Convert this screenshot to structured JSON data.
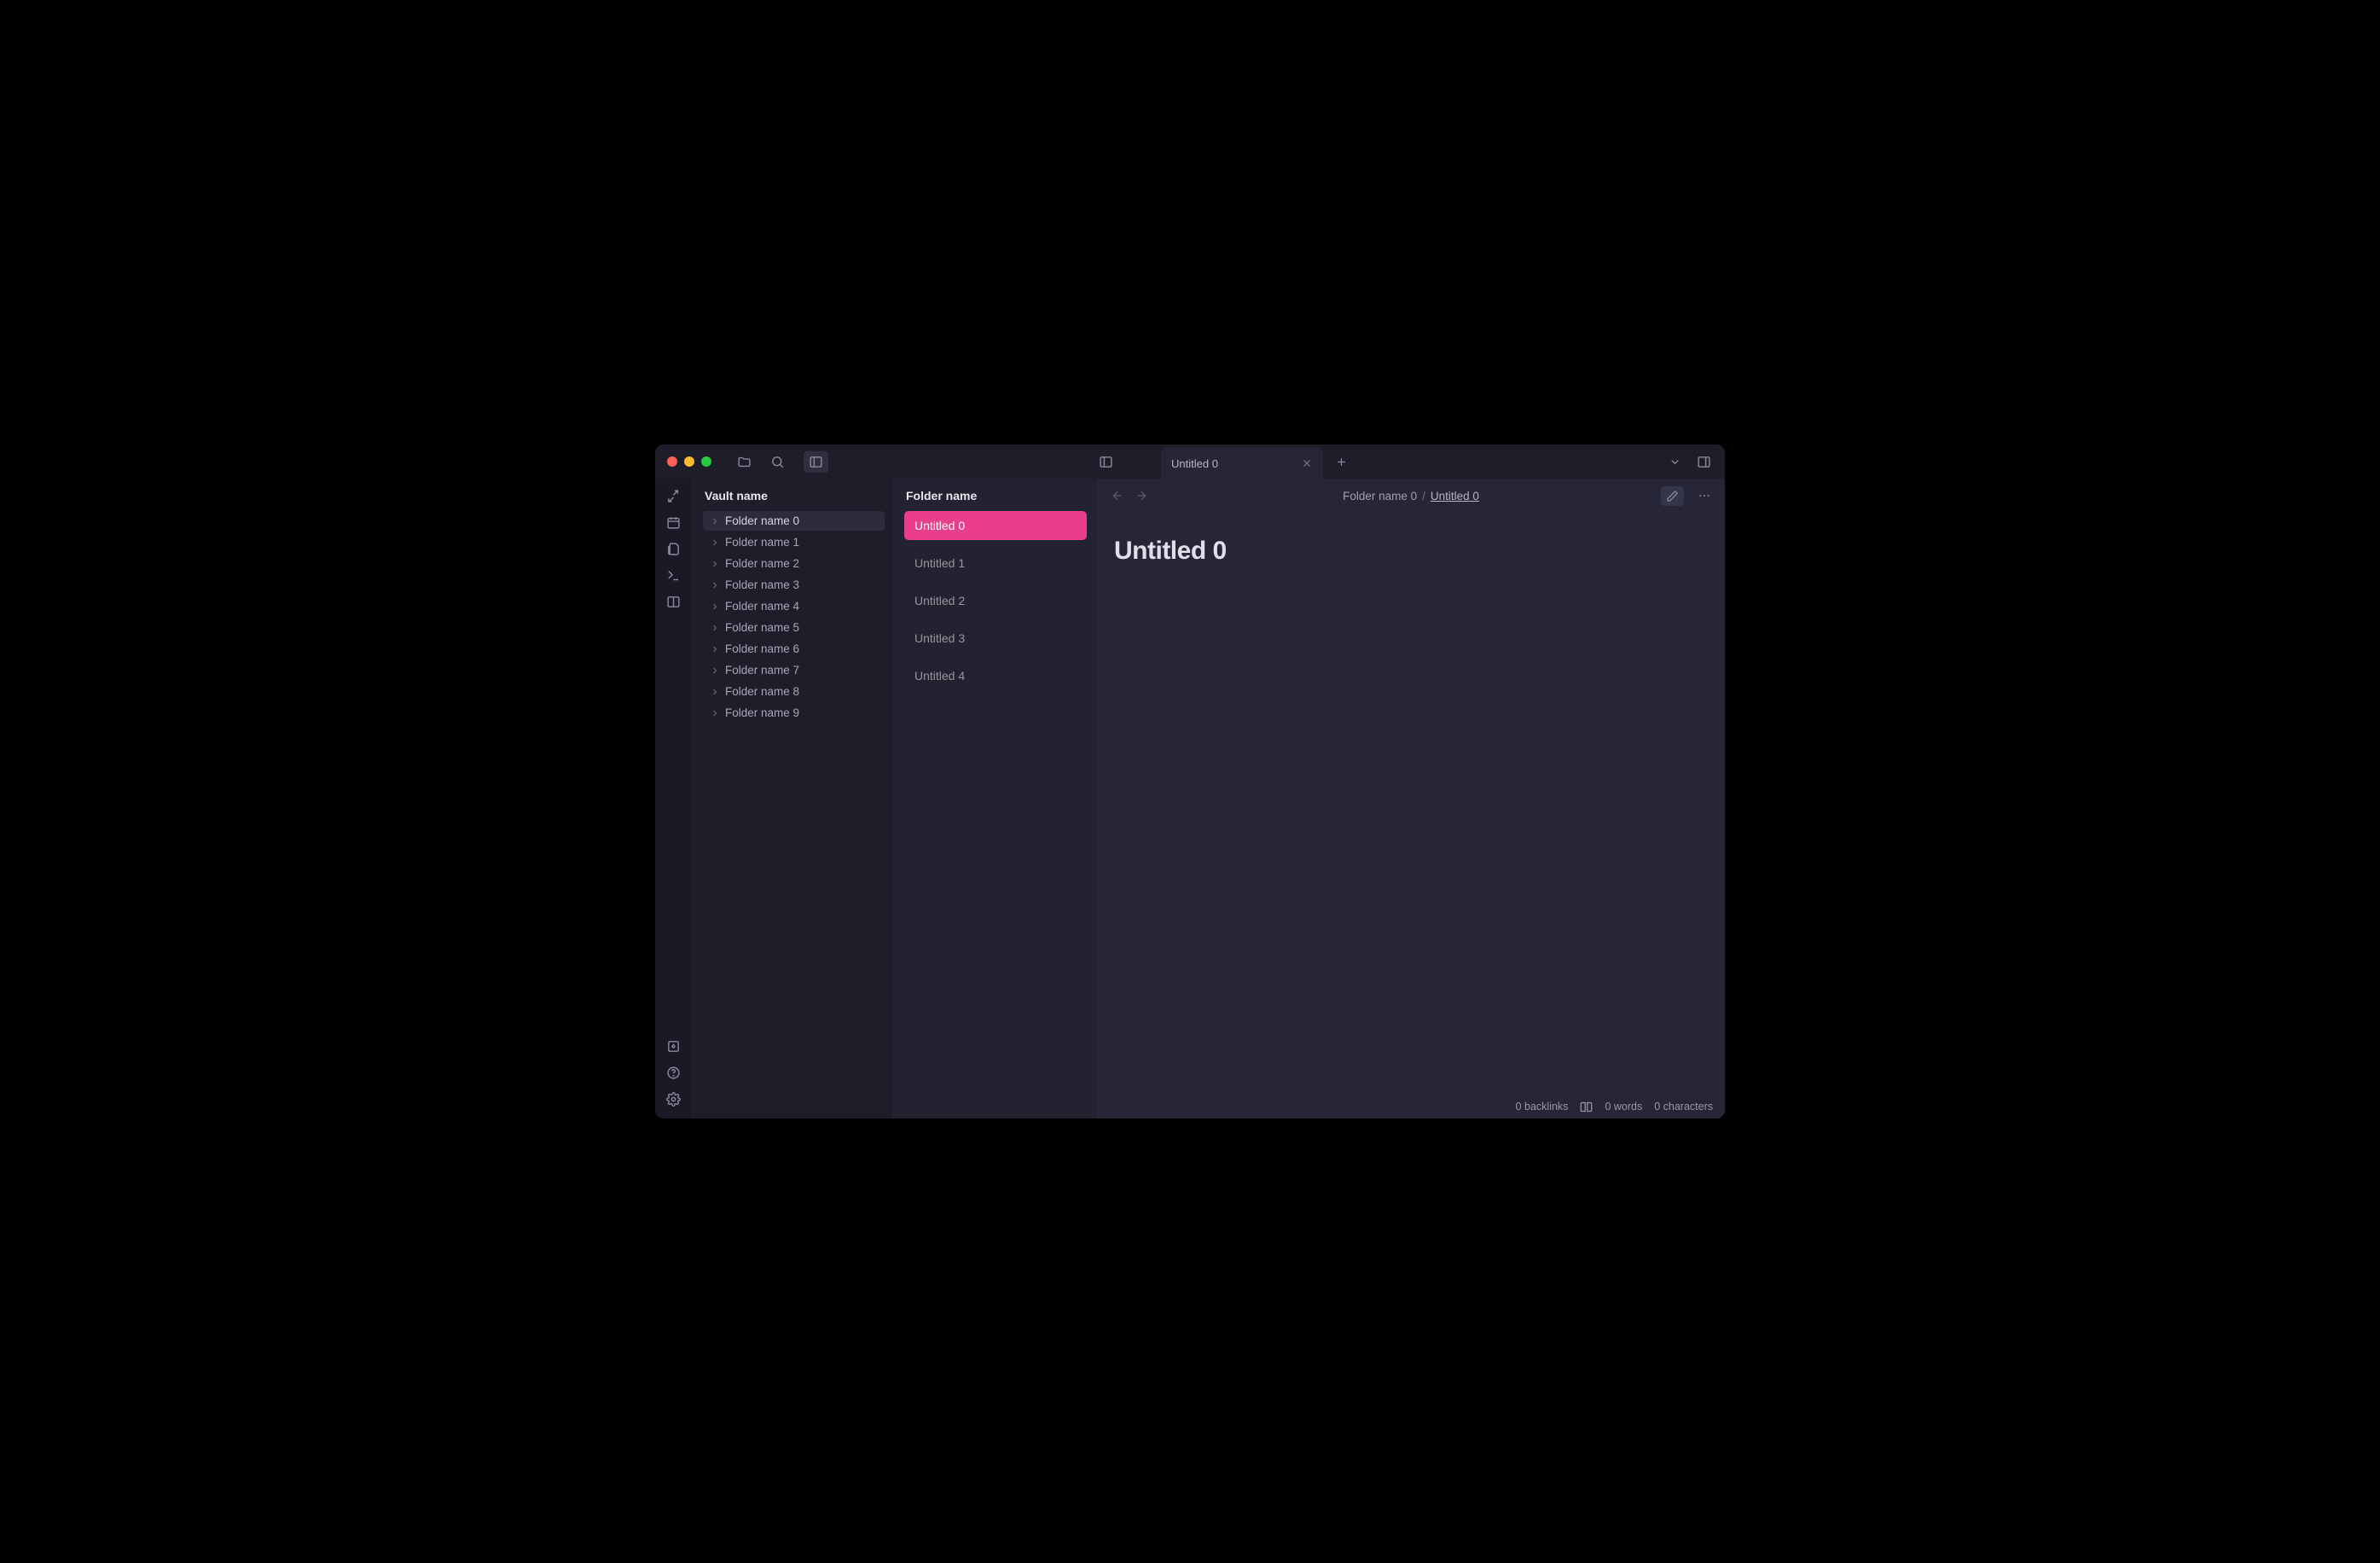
{
  "tab": {
    "title": "Untitled 0"
  },
  "vault": {
    "title": "Vault name",
    "folders": [
      {
        "label": "Folder name 0",
        "active": true
      },
      {
        "label": "Folder name 1",
        "active": false
      },
      {
        "label": "Folder name 2",
        "active": false
      },
      {
        "label": "Folder name 3",
        "active": false
      },
      {
        "label": "Folder name 4",
        "active": false
      },
      {
        "label": "Folder name 5",
        "active": false
      },
      {
        "label": "Folder name 6",
        "active": false
      },
      {
        "label": "Folder name 7",
        "active": false
      },
      {
        "label": "Folder name 8",
        "active": false
      },
      {
        "label": "Folder name 9",
        "active": false
      }
    ]
  },
  "folder": {
    "title": "Folder name",
    "files": [
      {
        "label": "Untitled 0",
        "active": true
      },
      {
        "label": "Untitled 1",
        "active": false
      },
      {
        "label": "Untitled 2",
        "active": false
      },
      {
        "label": "Untitled 3",
        "active": false
      },
      {
        "label": "Untitled 4",
        "active": false
      }
    ]
  },
  "breadcrumb": {
    "parent": "Folder name 0",
    "current": "Untitled 0"
  },
  "editor": {
    "title": "Untitled 0"
  },
  "status": {
    "backlinks": "0 backlinks",
    "words": "0 words",
    "characters": "0 characters"
  },
  "colors": {
    "accent": "#e83e8c"
  }
}
